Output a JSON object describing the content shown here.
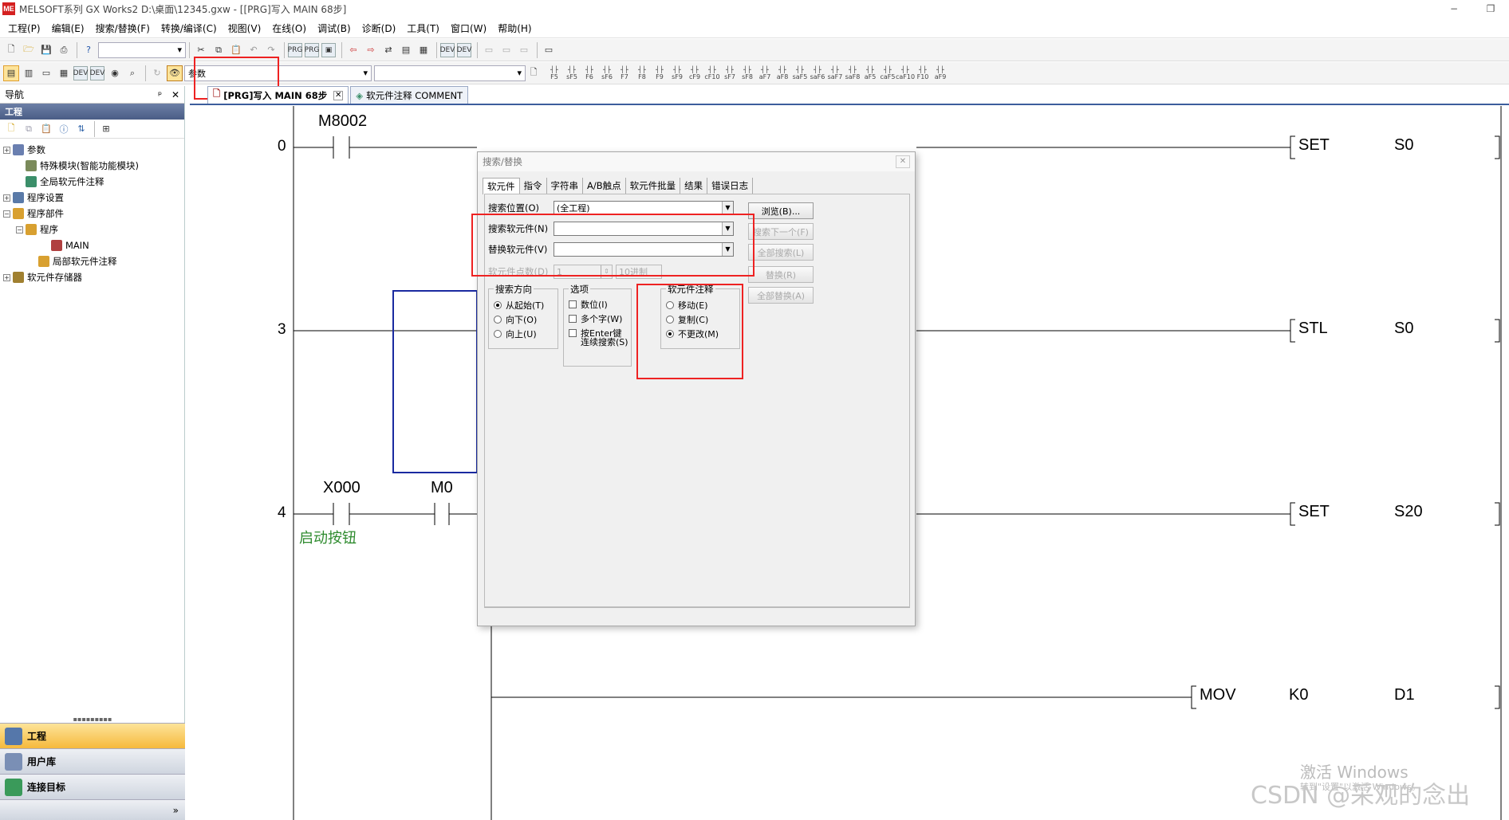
{
  "window": {
    "title": "MELSOFT系列 GX Works2 D:\\桌面\\12345.gxw - [[PRG]写入 MAIN 68步]",
    "app_icon_text": "ME",
    "minimize": "−",
    "restore": "❐"
  },
  "menu": [
    "工程(P)",
    "编辑(E)",
    "搜索/替换(F)",
    "转换/编译(C)",
    "视图(V)",
    "在线(O)",
    "调试(B)",
    "诊断(D)",
    "工具(T)",
    "窗口(W)",
    "帮助(H)"
  ],
  "toolbar": {
    "param_combo_value": "参数",
    "ladder_fn_labels": [
      "F5",
      "sF5",
      "F6",
      "sF6",
      "F7",
      "F8",
      "F9",
      "sF9",
      "cF9",
      "cF10",
      "sF7",
      "sF8",
      "aF7",
      "aF8",
      "saF5",
      "saF6",
      "saF7",
      "saF8",
      "aF5",
      "caF5",
      "caF10",
      "F10",
      "aF9"
    ]
  },
  "nav": {
    "header": "导航",
    "pin": "ᵖ",
    "close": "✕",
    "section": "工程",
    "tree": [
      {
        "label": "参数",
        "expander": "+",
        "indent": 0,
        "color": "#6a7fb0"
      },
      {
        "label": "特殊模块(智能功能模块)",
        "expander": "",
        "indent": 1,
        "color": "#7a8a5a"
      },
      {
        "label": "全局软元件注释",
        "expander": "",
        "indent": 1,
        "color": "#3b8f6a"
      },
      {
        "label": "程序设置",
        "expander": "+",
        "indent": 0,
        "color": "#5a7aa8"
      },
      {
        "label": "程序部件",
        "expander": "−",
        "indent": 0,
        "color": "#d8a030"
      },
      {
        "label": "程序",
        "expander": "−",
        "indent": 1,
        "color": "#d8a030"
      },
      {
        "label": "MAIN",
        "expander": "",
        "indent": 3,
        "color": "#b04040"
      },
      {
        "label": "局部软元件注释",
        "expander": "",
        "indent": 2,
        "color": "#d8a030"
      },
      {
        "label": "软元件存储器",
        "expander": "+",
        "indent": 0,
        "color": "#a08030"
      }
    ],
    "bottom": [
      {
        "label": "工程",
        "active": true,
        "color": "#5577aa"
      },
      {
        "label": "用户库",
        "active": false,
        "color": "#7a8fb5"
      },
      {
        "label": "连接目标",
        "active": false,
        "color": "#3a9a5a"
      }
    ],
    "more": "»"
  },
  "tabs": [
    {
      "label": "[PRG]写入 MAIN 68步",
      "active": true,
      "close": "✕"
    },
    {
      "label": "软元件注释 COMMENT",
      "active": false,
      "close": ""
    }
  ],
  "ladder": {
    "steps": [
      "0",
      "3",
      "4"
    ],
    "contacts": [
      "M8002",
      "X000",
      "M0"
    ],
    "comment": "启动按钮",
    "instructions": [
      {
        "op": "SET",
        "arg": "S0"
      },
      {
        "op": "STL",
        "arg": "S0"
      },
      {
        "op": "SET",
        "arg": "S20"
      },
      {
        "op": "MOV",
        "arg1": "K0",
        "arg2": "D1"
      }
    ]
  },
  "dialog": {
    "title": "搜索/替换",
    "close": "✕",
    "tabs": [
      "软元件",
      "指令",
      "字符串",
      "A/B触点",
      "软元件批量",
      "结果",
      "错误日志"
    ],
    "search_location_label": "搜索位置(O)",
    "search_location_value": "(全工程)",
    "search_device_label": "搜索软元件(N)",
    "search_device_value": "",
    "replace_device_label": "替换软元件(V)",
    "replace_device_value": "",
    "device_points_label": "软元件点数(D)",
    "device_points_value": "1",
    "radix_value": "10进制",
    "buttons": {
      "browse": "浏览(B)...",
      "find_next": "搜索下一个(F)",
      "find_all": "全部搜索(L)",
      "replace": "替换(R)",
      "replace_all": "全部替换(A)"
    },
    "direction": {
      "title": "搜索方向",
      "options": [
        "从起始(T)",
        "向下(O)",
        "向上(U)"
      ],
      "selected": 0
    },
    "options": {
      "title": "选项",
      "items": [
        "数位(I)",
        "多个字(W)",
        "按Enter键\n连续搜索(S)"
      ]
    },
    "comment": {
      "title": "软元件注释",
      "options": [
        "移动(E)",
        "复制(C)",
        "不更改(M)"
      ],
      "selected": 2
    }
  },
  "watermark": {
    "windows": "激活 Windows",
    "windows_sub": "转到\"设置\"以激活 Windows。",
    "csdn": "CSDN @采观的念出"
  },
  "colors": {
    "accent_blue": "#3c5d9c",
    "highlight_red": "#e22222",
    "comment_green": "#2e8b2e",
    "active_nav": "#f6b93c"
  }
}
